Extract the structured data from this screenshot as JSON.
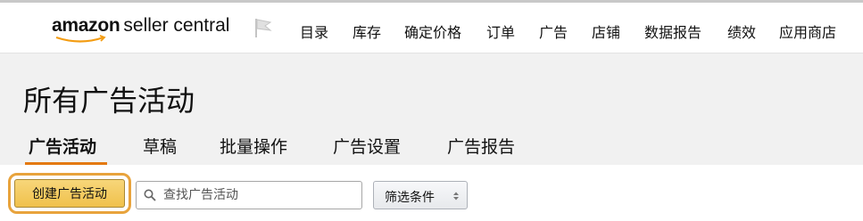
{
  "header": {
    "logo_brand": "amazon",
    "logo_suffix": "seller central",
    "flag_icon": "flag-icon",
    "nav": [
      {
        "label": "目录"
      },
      {
        "label": "库存"
      },
      {
        "label": "确定价格"
      },
      {
        "label": "订单"
      },
      {
        "label": "广告"
      },
      {
        "label": "店铺"
      },
      {
        "label": "数据报告"
      },
      {
        "label": "绩效"
      },
      {
        "label": "应用商店"
      }
    ]
  },
  "page": {
    "title": "所有广告活动",
    "tabs": [
      {
        "label": "广告活动",
        "active": true
      },
      {
        "label": "草稿",
        "active": false
      },
      {
        "label": "批量操作",
        "active": false
      },
      {
        "label": "广告设置",
        "active": false
      },
      {
        "label": "广告报告",
        "active": false
      }
    ]
  },
  "toolbar": {
    "create_label": "创建广告活动",
    "search_placeholder": "查找广告活动",
    "search_value": "",
    "search_icon": "search-icon",
    "filter_label": "筛选条件",
    "filter_icon": "updown-icon"
  },
  "colors": {
    "accent_highlight": "#e8a33c",
    "tab_underline": "#e47911",
    "primary_button": "#f0c14b",
    "content_bg": "#f1f1f1"
  }
}
